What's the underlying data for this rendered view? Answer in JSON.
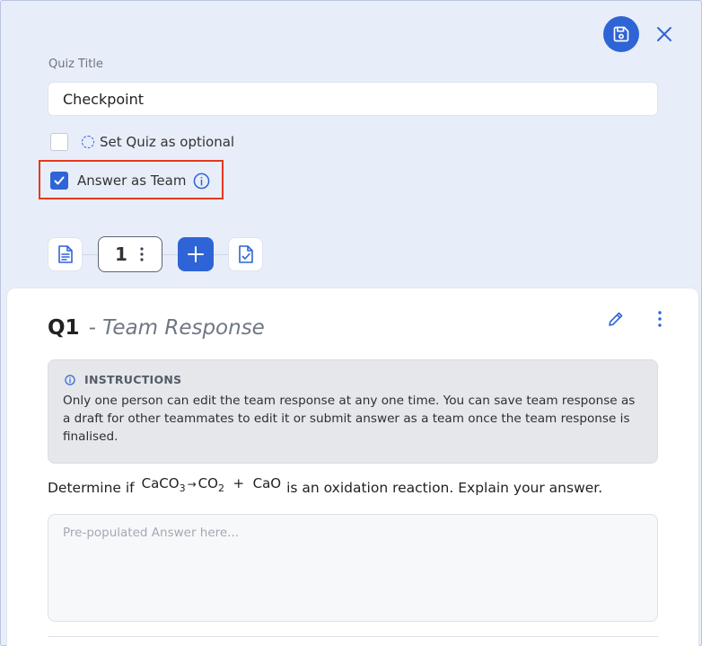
{
  "header": {
    "save_icon": "save-icon",
    "close_icon": "close-icon"
  },
  "form": {
    "title_label": "Quiz Title",
    "title_value": "Checkpoint",
    "optional_label": "Set Quiz as optional",
    "optional_checked": false,
    "team_label": "Answer as Team",
    "team_checked": true
  },
  "steps": {
    "question_number": "1",
    "icons": [
      "document-icon",
      "more-vertical-icon",
      "plus-icon",
      "checklist-icon"
    ]
  },
  "question": {
    "number": "Q1",
    "subtitle": "- Team Response",
    "instructions_heading": "INSTRUCTIONS",
    "instructions_text": "Only one person can edit the team response at any one time. You can save team response as a draft for other teammates to edit it or submit answer as a team once the team response is finalised.",
    "prompt_before": "Determine if",
    "prompt_after": "is an oxidation reaction. Explain your answer.",
    "formula": {
      "reactant": "CaCO",
      "reactant_sub": "3",
      "arrow": "→",
      "product1": "CO",
      "product1_sub": "2",
      "plus": "+",
      "product2": "CaO"
    },
    "answer_placeholder": "Pre-populated Answer here..."
  },
  "colors": {
    "accent": "#2f64d6",
    "highlight": "#e53820",
    "background": "#e8eef9"
  }
}
